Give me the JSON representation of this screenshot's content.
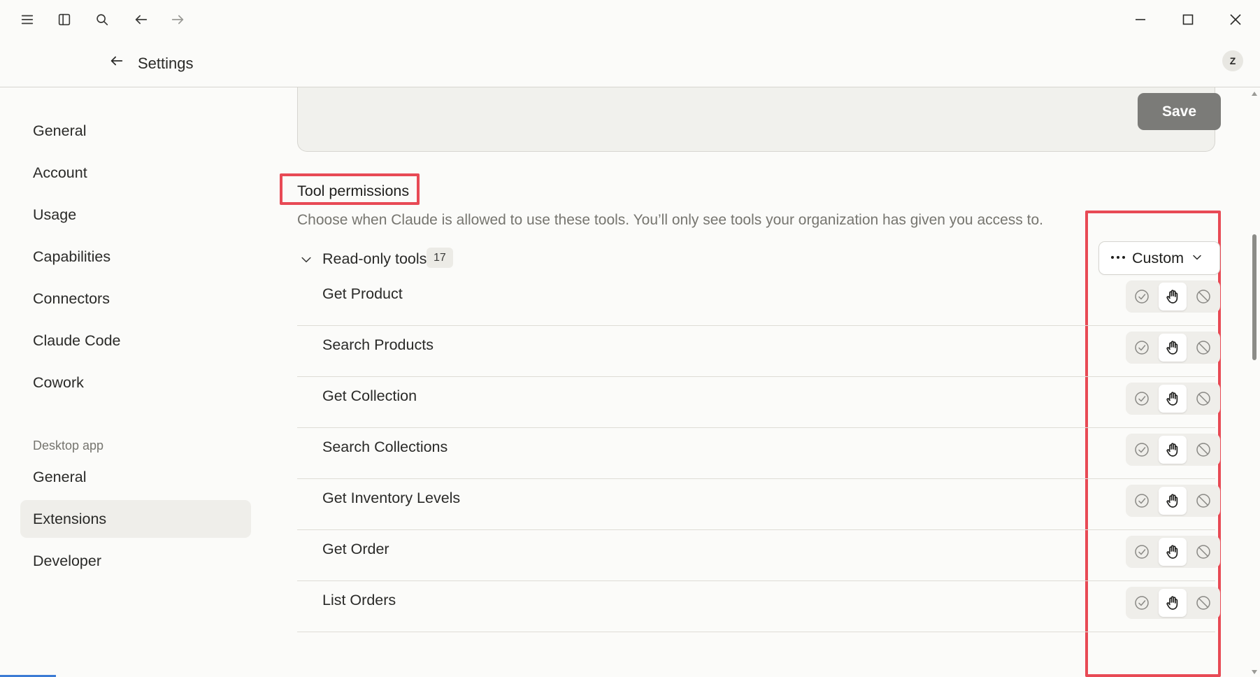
{
  "window": {
    "controls": {
      "minimize": "minimize-icon",
      "maximize": "maximize-icon",
      "close": "close-icon"
    }
  },
  "toolbar": {
    "icons": [
      "menu-icon",
      "sidebar-toggle-icon",
      "search-icon",
      "back-arrow-icon",
      "forward-arrow-icon"
    ]
  },
  "header": {
    "title": "Settings",
    "avatar_initial": "Z"
  },
  "sidebar": {
    "items": [
      {
        "label": "General"
      },
      {
        "label": "Account"
      },
      {
        "label": "Usage"
      },
      {
        "label": "Capabilities"
      },
      {
        "label": "Connectors"
      },
      {
        "label": "Claude Code"
      },
      {
        "label": "Cowork"
      }
    ],
    "desktop_section_label": "Desktop app",
    "desktop_items": [
      {
        "label": "General"
      },
      {
        "label": "Extensions",
        "active": true
      },
      {
        "label": "Developer"
      }
    ]
  },
  "card": {
    "save_label": "Save"
  },
  "tool_permissions": {
    "title": "Tool permissions",
    "description": "Choose when Claude is allowed to use these tools. You’ll only see tools your organization has given you access to.",
    "group": {
      "label": "Read-only tools",
      "count": "17",
      "mode_label": "Custom"
    },
    "tools": [
      {
        "name": "Get Product",
        "permission": "ask"
      },
      {
        "name": "Search Products",
        "permission": "ask"
      },
      {
        "name": "Get Collection",
        "permission": "ask"
      },
      {
        "name": "Search Collections",
        "permission": "ask"
      },
      {
        "name": "Get Inventory Levels",
        "permission": "ask"
      },
      {
        "name": "Get Order",
        "permission": "ask"
      },
      {
        "name": "List Orders",
        "permission": "ask"
      }
    ]
  },
  "colors": {
    "highlight": "#e84a55",
    "save_button": "#7b7b78",
    "active_nav": "#efeeea",
    "background": "#fbfbf9"
  }
}
